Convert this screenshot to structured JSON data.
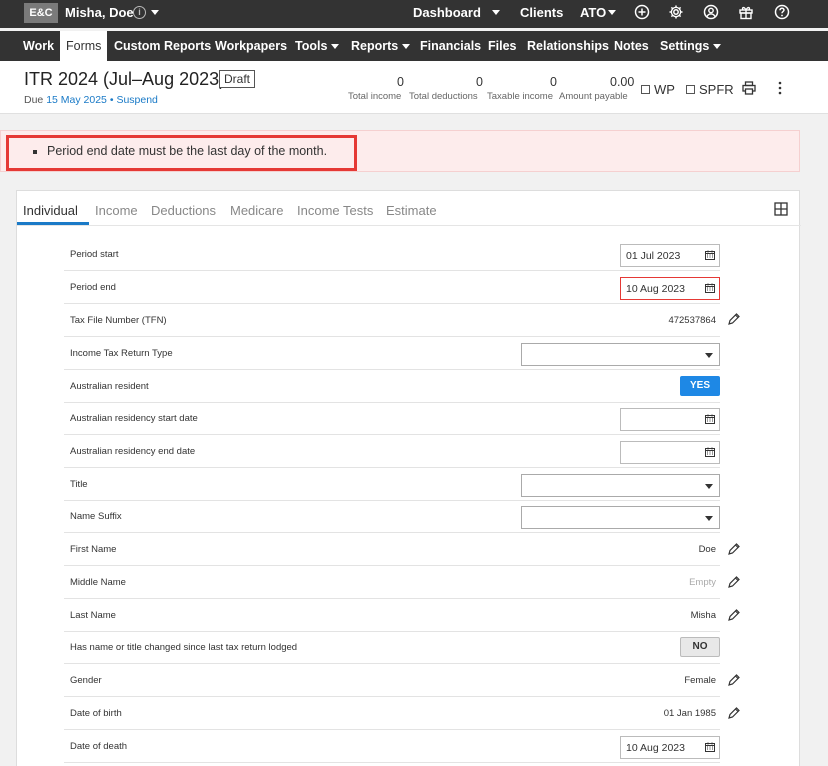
{
  "topbar": {
    "logo": "E&C",
    "user_name": "Misha, Doe",
    "info_glyph": "i",
    "nav": [
      "Dashboard",
      "Clients",
      "ATO"
    ]
  },
  "menu": {
    "items": [
      "Work",
      "Forms",
      "Custom Reports",
      "Workpapers",
      "Tools",
      "Reports",
      "Financials",
      "Files",
      "Relationships",
      "Notes",
      "Settings"
    ],
    "active": "Forms"
  },
  "header": {
    "title": "ITR 2024 (Jul–Aug 2023)",
    "badge": "Draft",
    "due_prefix": "Due",
    "due_date": "15 May 2025",
    "separator": "•",
    "suspend_link": "Suspend",
    "stats": [
      {
        "value": "0",
        "label": "Total income"
      },
      {
        "value": "0",
        "label": "Total deductions"
      },
      {
        "value": "0",
        "label": "Taxable income"
      },
      {
        "value": "0.00",
        "label": "Amount payable"
      }
    ],
    "checkboxes": [
      "WP",
      "SPFR"
    ]
  },
  "alert": {
    "message": "Period end date must be the last day of the month."
  },
  "tabs": {
    "items": [
      "Individual",
      "Income",
      "Deductions",
      "Medicare",
      "Income Tests",
      "Estimate"
    ],
    "active": "Individual"
  },
  "form": {
    "rows": [
      {
        "label": "Period start",
        "type": "date",
        "value": "01 Jul 2023"
      },
      {
        "label": "Period end",
        "type": "date",
        "value": "10 Aug 2023",
        "error": true
      },
      {
        "label": "Tax File Number (TFN)",
        "type": "text",
        "value": "472537864"
      },
      {
        "label": "Income Tax Return Type",
        "type": "select",
        "value": ""
      },
      {
        "label": "Australian resident",
        "type": "toggle",
        "value": "YES"
      },
      {
        "label": "Australian residency start date",
        "type": "date",
        "value": ""
      },
      {
        "label": "Australian residency end date",
        "type": "date",
        "value": ""
      },
      {
        "label": "Title",
        "type": "select",
        "value": ""
      },
      {
        "label": "Name Suffix",
        "type": "select",
        "value": ""
      },
      {
        "label": "First Name",
        "type": "text",
        "value": "Doe"
      },
      {
        "label": "Middle Name",
        "type": "text",
        "value": "Empty",
        "placeholder": true
      },
      {
        "label": "Last Name",
        "type": "text",
        "value": "Misha"
      },
      {
        "label": "Has name or title changed since last tax return lodged",
        "type": "toggle",
        "value": "NO"
      },
      {
        "label": "Gender",
        "type": "text",
        "value": "Female"
      },
      {
        "label": "Date of birth",
        "type": "text",
        "value": "01 Jan 1985"
      },
      {
        "label": "Date of death",
        "type": "date",
        "value": "10 Aug 2023"
      }
    ]
  },
  "colors": {
    "topbar_bg": "#333333",
    "accent": "#1a7ac7",
    "yes_button": "#1e88e5",
    "error": "#e53935",
    "alert_bg": "#fdecec"
  },
  "icons": [
    "info-icon",
    "plus-circle-icon",
    "gear-icon",
    "user-circle-icon",
    "gift-icon",
    "help-icon",
    "print-icon",
    "kebab-icon",
    "grid-icon",
    "calendar-icon",
    "pencil-icon"
  ]
}
